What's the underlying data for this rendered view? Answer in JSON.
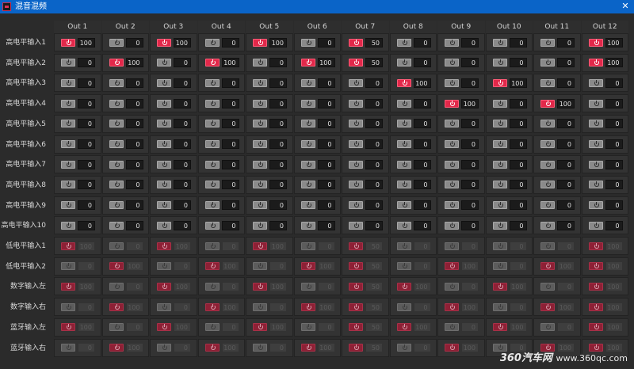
{
  "window": {
    "title": "混音混频",
    "close_glyph": "✕"
  },
  "accent_colors": [
    "#e83a56",
    "#8ad83a",
    "#8a58d8",
    "#3aa0a0",
    "#d83a8a",
    "#3ad8a0",
    "#e8b83a",
    "#3a8ad8",
    "#e8803a",
    "#3a6ad8",
    "#3ad85a",
    "#e83a3a"
  ],
  "columns": [
    "Out 1",
    "Out 2",
    "Out 3",
    "Out 4",
    "Out 5",
    "Out 6",
    "Out 7",
    "Out 8",
    "Out 9",
    "Out 10",
    "Out 11",
    "Out 12"
  ],
  "rows": [
    {
      "label": "高电平输入1",
      "dim": false,
      "cells": [
        [
          1,
          "100"
        ],
        [
          0,
          "0"
        ],
        [
          1,
          "100"
        ],
        [
          0,
          "0"
        ],
        [
          1,
          "100"
        ],
        [
          0,
          "0"
        ],
        [
          1,
          "50"
        ],
        [
          0,
          "0"
        ],
        [
          0,
          "0"
        ],
        [
          0,
          "0"
        ],
        [
          0,
          "0"
        ],
        [
          1,
          "100"
        ]
      ]
    },
    {
      "label": "高电平输入2",
      "dim": false,
      "cells": [
        [
          0,
          "0"
        ],
        [
          1,
          "100"
        ],
        [
          0,
          "0"
        ],
        [
          1,
          "100"
        ],
        [
          0,
          "0"
        ],
        [
          1,
          "100"
        ],
        [
          1,
          "50"
        ],
        [
          0,
          "0"
        ],
        [
          0,
          "0"
        ],
        [
          0,
          "0"
        ],
        [
          0,
          "0"
        ],
        [
          1,
          "100"
        ]
      ]
    },
    {
      "label": "高电平输入3",
      "dim": false,
      "cells": [
        [
          0,
          "0"
        ],
        [
          0,
          "0"
        ],
        [
          0,
          "0"
        ],
        [
          0,
          "0"
        ],
        [
          0,
          "0"
        ],
        [
          0,
          "0"
        ],
        [
          0,
          "0"
        ],
        [
          1,
          "100"
        ],
        [
          0,
          "0"
        ],
        [
          1,
          "100"
        ],
        [
          0,
          "0"
        ],
        [
          0,
          "0"
        ]
      ]
    },
    {
      "label": "高电平输入4",
      "dim": false,
      "cells": [
        [
          0,
          "0"
        ],
        [
          0,
          "0"
        ],
        [
          0,
          "0"
        ],
        [
          0,
          "0"
        ],
        [
          0,
          "0"
        ],
        [
          0,
          "0"
        ],
        [
          0,
          "0"
        ],
        [
          0,
          "0"
        ],
        [
          1,
          "100"
        ],
        [
          0,
          "0"
        ],
        [
          1,
          "100"
        ],
        [
          0,
          "0"
        ]
      ]
    },
    {
      "label": "高电平输入5",
      "dim": false,
      "cells": [
        [
          0,
          "0"
        ],
        [
          0,
          "0"
        ],
        [
          0,
          "0"
        ],
        [
          0,
          "0"
        ],
        [
          0,
          "0"
        ],
        [
          0,
          "0"
        ],
        [
          0,
          "0"
        ],
        [
          0,
          "0"
        ],
        [
          0,
          "0"
        ],
        [
          0,
          "0"
        ],
        [
          0,
          "0"
        ],
        [
          0,
          "0"
        ]
      ]
    },
    {
      "label": "高电平输入6",
      "dim": false,
      "cells": [
        [
          0,
          "0"
        ],
        [
          0,
          "0"
        ],
        [
          0,
          "0"
        ],
        [
          0,
          "0"
        ],
        [
          0,
          "0"
        ],
        [
          0,
          "0"
        ],
        [
          0,
          "0"
        ],
        [
          0,
          "0"
        ],
        [
          0,
          "0"
        ],
        [
          0,
          "0"
        ],
        [
          0,
          "0"
        ],
        [
          0,
          "0"
        ]
      ]
    },
    {
      "label": "高电平输入7",
      "dim": false,
      "cells": [
        [
          0,
          "0"
        ],
        [
          0,
          "0"
        ],
        [
          0,
          "0"
        ],
        [
          0,
          "0"
        ],
        [
          0,
          "0"
        ],
        [
          0,
          "0"
        ],
        [
          0,
          "0"
        ],
        [
          0,
          "0"
        ],
        [
          0,
          "0"
        ],
        [
          0,
          "0"
        ],
        [
          0,
          "0"
        ],
        [
          0,
          "0"
        ]
      ]
    },
    {
      "label": "高电平输入8",
      "dim": false,
      "cells": [
        [
          0,
          "0"
        ],
        [
          0,
          "0"
        ],
        [
          0,
          "0"
        ],
        [
          0,
          "0"
        ],
        [
          0,
          "0"
        ],
        [
          0,
          "0"
        ],
        [
          0,
          "0"
        ],
        [
          0,
          "0"
        ],
        [
          0,
          "0"
        ],
        [
          0,
          "0"
        ],
        [
          0,
          "0"
        ],
        [
          0,
          "0"
        ]
      ]
    },
    {
      "label": "高电平输入9",
      "dim": false,
      "cells": [
        [
          0,
          "0"
        ],
        [
          0,
          "0"
        ],
        [
          0,
          "0"
        ],
        [
          0,
          "0"
        ],
        [
          0,
          "0"
        ],
        [
          0,
          "0"
        ],
        [
          0,
          "0"
        ],
        [
          0,
          "0"
        ],
        [
          0,
          "0"
        ],
        [
          0,
          "0"
        ],
        [
          0,
          "0"
        ],
        [
          0,
          "0"
        ]
      ]
    },
    {
      "label": "高电平输入10",
      "dim": false,
      "cells": [
        [
          0,
          "0"
        ],
        [
          0,
          "0"
        ],
        [
          0,
          "0"
        ],
        [
          0,
          "0"
        ],
        [
          0,
          "0"
        ],
        [
          0,
          "0"
        ],
        [
          0,
          "0"
        ],
        [
          0,
          "0"
        ],
        [
          0,
          "0"
        ],
        [
          0,
          "0"
        ],
        [
          0,
          "0"
        ],
        [
          0,
          "0"
        ]
      ]
    },
    {
      "label": "低电平输入1",
      "dim": true,
      "cells": [
        [
          1,
          "100"
        ],
        [
          0,
          "0"
        ],
        [
          1,
          "100"
        ],
        [
          0,
          "0"
        ],
        [
          1,
          "100"
        ],
        [
          0,
          "0"
        ],
        [
          1,
          "50"
        ],
        [
          0,
          "0"
        ],
        [
          0,
          "0"
        ],
        [
          0,
          "0"
        ],
        [
          0,
          "0"
        ],
        [
          1,
          "100"
        ]
      ]
    },
    {
      "label": "低电平输入2",
      "dim": true,
      "cells": [
        [
          0,
          "0"
        ],
        [
          1,
          "100"
        ],
        [
          0,
          "0"
        ],
        [
          1,
          "100"
        ],
        [
          0,
          "0"
        ],
        [
          1,
          "100"
        ],
        [
          1,
          "50"
        ],
        [
          0,
          "0"
        ],
        [
          1,
          "100"
        ],
        [
          0,
          "0"
        ],
        [
          1,
          "100"
        ],
        [
          1,
          "100"
        ]
      ]
    },
    {
      "label": "数字输入左",
      "dim": true,
      "cells": [
        [
          1,
          "100"
        ],
        [
          0,
          "0"
        ],
        [
          1,
          "100"
        ],
        [
          0,
          "0"
        ],
        [
          1,
          "100"
        ],
        [
          0,
          "0"
        ],
        [
          1,
          "50"
        ],
        [
          1,
          "100"
        ],
        [
          0,
          "0"
        ],
        [
          1,
          "100"
        ],
        [
          0,
          "0"
        ],
        [
          1,
          "100"
        ]
      ]
    },
    {
      "label": "数字输入右",
      "dim": true,
      "cells": [
        [
          0,
          "0"
        ],
        [
          1,
          "100"
        ],
        [
          0,
          "0"
        ],
        [
          1,
          "100"
        ],
        [
          0,
          "0"
        ],
        [
          1,
          "100"
        ],
        [
          1,
          "50"
        ],
        [
          0,
          "0"
        ],
        [
          1,
          "100"
        ],
        [
          0,
          "0"
        ],
        [
          1,
          "100"
        ],
        [
          1,
          "100"
        ]
      ]
    },
    {
      "label": "蓝牙输入左",
      "dim": true,
      "cells": [
        [
          1,
          "100"
        ],
        [
          0,
          "0"
        ],
        [
          1,
          "100"
        ],
        [
          0,
          "0"
        ],
        [
          1,
          "100"
        ],
        [
          0,
          "0"
        ],
        [
          1,
          "50"
        ],
        [
          1,
          "100"
        ],
        [
          0,
          "0"
        ],
        [
          1,
          "100"
        ],
        [
          0,
          "0"
        ],
        [
          1,
          "100"
        ]
      ]
    },
    {
      "label": "蓝牙输入右",
      "dim": true,
      "cells": [
        [
          0,
          "0"
        ],
        [
          1,
          "100"
        ],
        [
          0,
          "0"
        ],
        [
          1,
          "100"
        ],
        [
          0,
          "0"
        ],
        [
          1,
          "100"
        ],
        [
          1,
          "50"
        ],
        [
          0,
          "0"
        ],
        [
          1,
          "100"
        ],
        [
          0,
          "0"
        ],
        [
          1,
          "100"
        ],
        [
          1,
          "100"
        ]
      ]
    }
  ],
  "watermark": {
    "main": "360汽车网",
    "site": "www.360qc.com"
  }
}
